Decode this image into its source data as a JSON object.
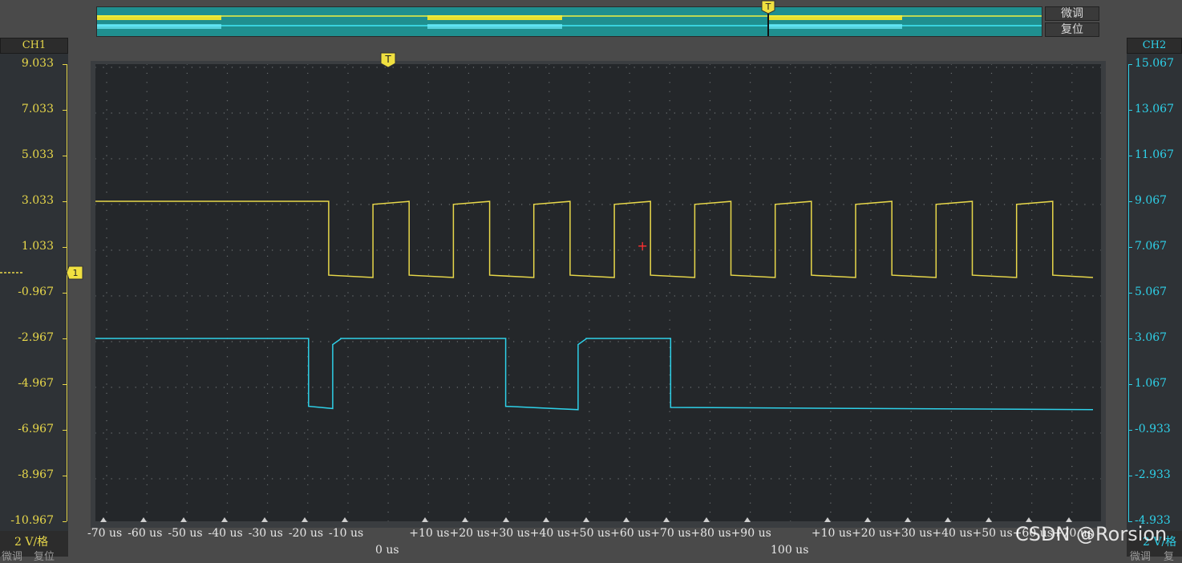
{
  "overview": {
    "fine_tune_label": "微调",
    "reset_label": "复位"
  },
  "channels": {
    "ch1": {
      "label": "CH1",
      "color": "#e8d84a",
      "scale_label": "2 V/格",
      "y_ticks": [
        "9.033",
        "7.033",
        "5.033",
        "3.033",
        "1.033",
        "-0.967",
        "-2.967",
        "-4.967",
        "-6.967",
        "-8.967",
        "-10.967"
      ]
    },
    "ch2": {
      "label": "CH2",
      "color": "#2ed0e8",
      "scale_label": "2 V/格",
      "y_ticks": [
        "15.067",
        "13.067",
        "11.067",
        "9.067",
        "7.067",
        "5.067",
        "3.067",
        "1.067",
        "-0.933",
        "-2.933",
        "-4.933"
      ]
    }
  },
  "bottom_left": {
    "fine_tune_label": "微调",
    "reset_label": "复位"
  },
  "bottom_right": {
    "fine_tune_label": "微调",
    "reset_label": "复"
  },
  "x_axis": {
    "ticks": [
      "-70 us",
      "-60 us",
      "-50 us",
      "-40 us",
      "-30 us",
      "-20 us",
      "-10 us",
      "+10 us",
      "+20 us",
      "+30 us",
      "+40 us",
      "+50 us",
      "+60 us",
      "+70 us",
      "+80 us",
      "+90 us",
      "+10 us",
      "+20 us",
      "+30 us",
      "+40 us",
      "+50 us",
      "+60 us",
      "+70 us"
    ],
    "origin_label": "0 us",
    "mid_label": "100 us"
  },
  "trigger_marker": "T",
  "level_marker": "1",
  "watermark": "CSDN @Rorsion",
  "chart_data": {
    "type": "line",
    "xlabel": "",
    "xlim": [
      -72,
      178
    ],
    "series": [
      {
        "name": "CH1",
        "x": [
          -72,
          -14,
          -14,
          -3,
          -3,
          6,
          6,
          17,
          17,
          26,
          26,
          37,
          37,
          46,
          46,
          57,
          57,
          66,
          66,
          77,
          77,
          86,
          86,
          97,
          97,
          106,
          106,
          117,
          117,
          126,
          126,
          137,
          137,
          146,
          146,
          157,
          157,
          166,
          166,
          176
        ],
        "y": [
          3.033,
          3.033,
          -0.2,
          -0.3,
          2.9,
          3.03,
          -0.2,
          -0.3,
          2.9,
          3.03,
          -0.2,
          -0.3,
          2.9,
          3.03,
          -0.2,
          -0.3,
          2.9,
          3.03,
          -0.2,
          -0.3,
          2.9,
          3.03,
          -0.2,
          -0.3,
          2.9,
          3.03,
          -0.2,
          -0.3,
          2.9,
          3.03,
          -0.2,
          -0.3,
          2.9,
          3.03,
          -0.2,
          -0.3,
          2.9,
          3.03,
          -0.2,
          -0.3
        ],
        "ylim": [
          -10.967,
          9.033
        ]
      },
      {
        "name": "CH2",
        "x": [
          -72,
          -19,
          -19,
          -13,
          -13,
          -11,
          -11,
          30,
          30,
          48,
          48,
          50,
          50,
          71,
          71,
          176
        ],
        "y": [
          3.067,
          3.067,
          0.1,
          0.0,
          2.8,
          3.05,
          3.067,
          3.067,
          0.1,
          -0.05,
          2.8,
          3.05,
          3.067,
          3.067,
          0.05,
          -0.05
        ],
        "ylim": [
          -4.933,
          15.067
        ]
      }
    ]
  }
}
